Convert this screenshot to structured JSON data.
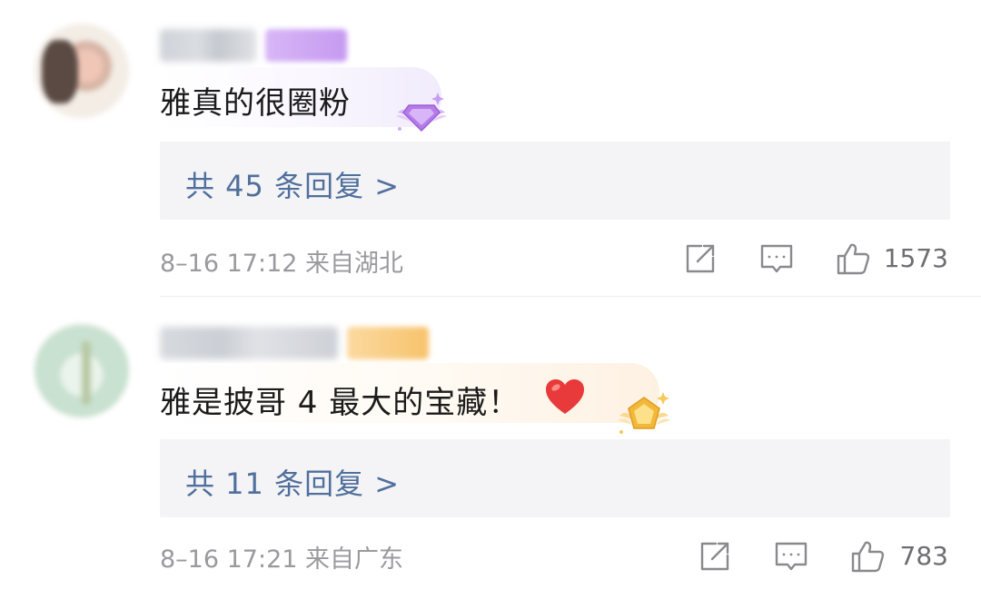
{
  "comments": [
    {
      "text": "雅真的很圈粉",
      "replies_label": "共 45 条回复 >",
      "meta": "8–16 17:12  来自湖北",
      "likes": "1573",
      "badge_color": "#c59af1",
      "gem_color": "#b57be8"
    },
    {
      "text": "雅是披哥 4 最大的宝藏！",
      "replies_label": "共 11 条回复 >",
      "meta": "8–16 17:21  来自广东",
      "likes": "783",
      "badge_color": "#f7c36c",
      "gem_color": "#f3b73a"
    }
  ],
  "colors": {
    "link_blue": "#4f6f9c",
    "meta_gray": "#9a9a9e",
    "reply_bg": "#f4f4f6",
    "heart_red": "#e83a3a"
  },
  "icons": [
    "share-icon",
    "comment-icon",
    "like-icon",
    "heart-emoji",
    "diamond-badge-icon",
    "gold-badge-icon"
  ]
}
